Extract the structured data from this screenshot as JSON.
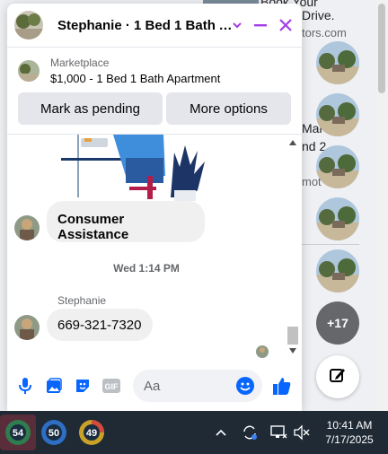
{
  "background": {
    "snippet_1": "Book Your",
    "snippet_2": "Drive.",
    "snippet_3": "tors.com",
    "snippet_4": "Mar",
    "snippet_5": "nd 2",
    "snippet_6": "mot"
  },
  "chat": {
    "title": "Stephanie · 1 Bed 1 Bath A...",
    "listing": {
      "category": "Marketplace",
      "price_title": "$1,000 - 1 Bed 1 Bath Apartment"
    },
    "buttons": {
      "mark_pending": "Mark as pending",
      "more_options": "More options"
    },
    "messages": {
      "bubble_1": "Consumer Assistance",
      "timestamp": "Wed 1:14 PM",
      "sender": "Stephanie",
      "bubble_2": "669-321-7320"
    },
    "composer_placeholder": "Aa",
    "accent": "#a33de6",
    "blue": "#0866ff"
  },
  "rail": {
    "more_count": "+17"
  },
  "taskbar": {
    "app_1_badge": "54",
    "app_2_badge": "50",
    "app_3_badge": "49",
    "time": "10:41 AM",
    "date": "7/17/2025"
  }
}
